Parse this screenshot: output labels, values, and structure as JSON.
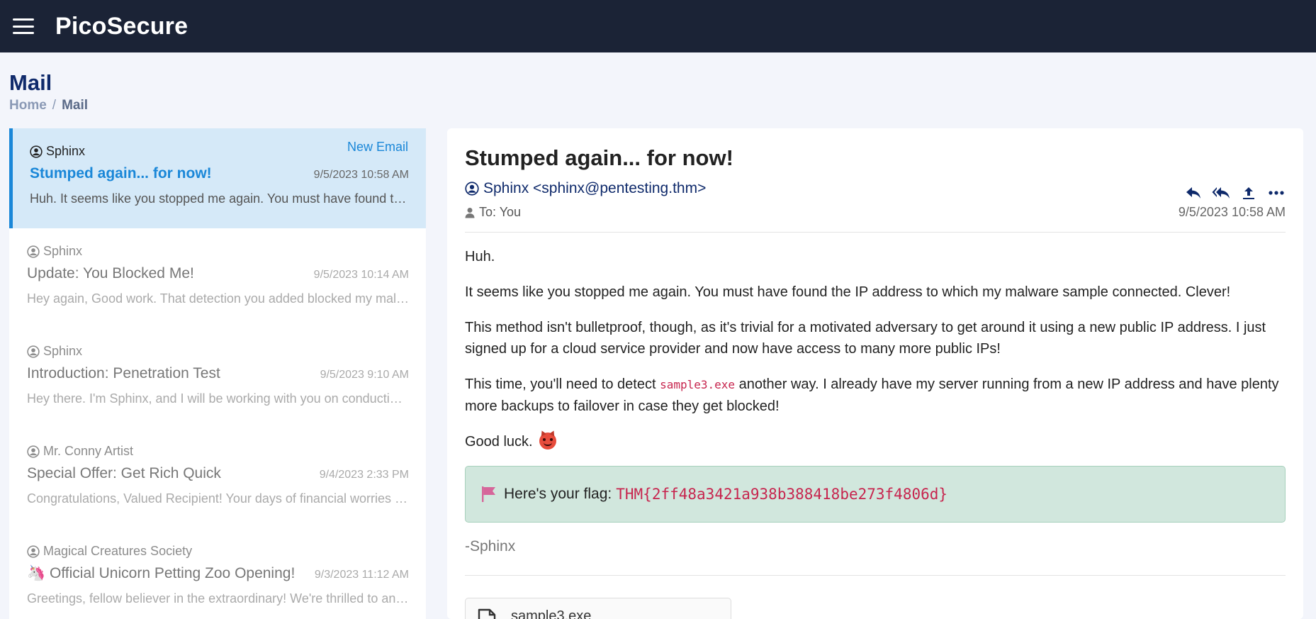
{
  "app": {
    "brand": "PicoSecure"
  },
  "page": {
    "title": "Mail"
  },
  "breadcrumb": {
    "home": "Home",
    "separator": "/",
    "current": "Mail"
  },
  "mail_list": [
    {
      "sender": "Sphinx",
      "badge": "New Email",
      "subject": "Stumped again... for now!",
      "date": "9/5/2023 10:58 AM",
      "preview": "Huh. It seems like you stopped me again. You must have found the IP address to which my malware sample connected.",
      "active": true
    },
    {
      "sender": "Sphinx",
      "subject": "Update: You Blocked Me!",
      "date": "9/5/2023 10:14 AM",
      "preview": "Hey again, Good work. That detection you added blocked my malware sample from running."
    },
    {
      "sender": "Sphinx",
      "subject": "Introduction: Penetration Test",
      "date": "9/5/2023 9:10 AM",
      "preview": "Hey there. I'm Sphinx, and I will be working with you on conducting a penetration test."
    },
    {
      "sender": "Mr. Conny Artist",
      "subject": "Special Offer: Get Rich Quick",
      "date": "9/4/2023 2:33 PM",
      "preview": "Congratulations, Valued Recipient! Your days of financial worries are over."
    },
    {
      "sender": "Magical Creatures Society",
      "subject_emoji": "🦄",
      "subject": "Official Unicorn Petting Zoo Opening!",
      "date": "9/3/2023 11:12 AM",
      "preview": "Greetings, fellow believer in the extraordinary! We're thrilled to announce the opening."
    }
  ],
  "detail": {
    "subject": "Stumped again... for now!",
    "from": "Sphinx <sphinx@pentesting.thm>",
    "to": "To: You",
    "date": "9/5/2023 10:58 AM",
    "body": {
      "p1": "Huh.",
      "p2": "It seems like you stopped me again. You must have found the IP address to which my malware sample connected. Clever!",
      "p3": "This method isn't bulletproof, though, as it's trivial for a motivated adversary to get around it using a new public IP address. I just signed up for a cloud service provider and now have access to many more public IPs!",
      "p4_before": "This time, you'll need to detect ",
      "p4_code": "sample3.exe",
      "p4_after": " another way. I already have my server running from a new IP address and have plenty more backups to failover in case they get blocked!",
      "p5": "Good luck."
    },
    "flag_label": "Here's your flag:",
    "flag_value": "THM{2ff48a3421a938b388418be273f4806d}",
    "signature": "-Sphinx",
    "attachment": "sample3.exe"
  },
  "colors": {
    "topbar": "#1b2336",
    "accent": "#1a87d8",
    "title": "#0f2a6b",
    "flag_bg": "#d1e7dd",
    "code": "#c7254e",
    "active_item_bg": "#d5e9f8"
  },
  "icons": [
    "menu-icon",
    "user-circle-icon",
    "user-icon",
    "reply-icon",
    "reply-all-icon",
    "forward-icon",
    "more-icon",
    "flag-icon",
    "devil-emoji-icon",
    "unicorn-emoji-icon",
    "file-icon"
  ]
}
